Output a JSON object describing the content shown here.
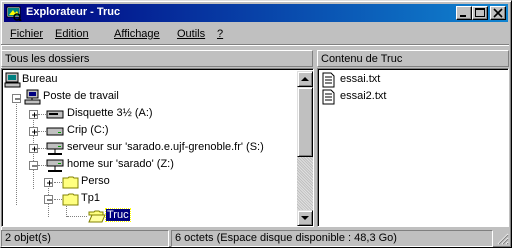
{
  "window": {
    "title": "Explorateur - Truc",
    "buttons": [
      "minimize",
      "maximize",
      "close"
    ]
  },
  "menu": {
    "items": [
      {
        "label": "Fichier"
      },
      {
        "label": "Edition"
      },
      {
        "label": "Affichage"
      },
      {
        "label": "Outils"
      },
      {
        "label": "?"
      }
    ]
  },
  "left_pane": {
    "header": "Tous les dossiers",
    "tree": [
      {
        "label": "Bureau",
        "icon": "desktop-icon"
      },
      {
        "label": "Poste de travail",
        "icon": "computer-icon",
        "expander": "minus"
      },
      {
        "label": "Disquette 3½ (A:)",
        "icon": "floppy-drive-icon",
        "expander": "plus"
      },
      {
        "label": "Crip (C:)",
        "icon": "hard-drive-icon",
        "expander": "plus"
      },
      {
        "label": "serveur sur 'sarado.e.ujf-grenoble.fr' (S:)",
        "icon": "network-drive-icon",
        "expander": "plus"
      },
      {
        "label": "home sur 'sarado' (Z:)",
        "icon": "network-drive-icon",
        "expander": "minus"
      },
      {
        "label": "Perso",
        "icon": "folder-icon",
        "expander": "plus"
      },
      {
        "label": "Tp1",
        "icon": "folder-icon",
        "expander": "minus"
      },
      {
        "label": "Truc",
        "icon": "open-folder-icon",
        "selected": true
      }
    ]
  },
  "right_pane": {
    "header": "Contenu de Truc",
    "files": [
      {
        "label": "essai.txt",
        "icon": "text-file-icon"
      },
      {
        "label": "essai2.txt",
        "icon": "text-file-icon"
      }
    ]
  },
  "status": {
    "count": "2 objet(s)",
    "info": "6 octets (Espace disque disponible : 48,3 Go)"
  },
  "colors": {
    "titlebar_start": "#000080",
    "titlebar_end": "#1084d0",
    "face": "#c0c0c0",
    "selection": "#000080"
  }
}
